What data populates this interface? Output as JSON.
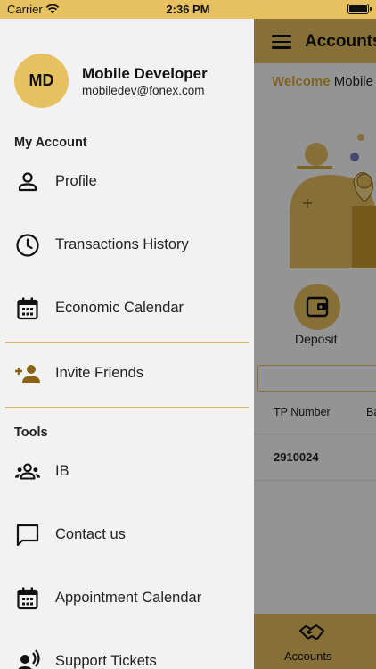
{
  "status_bar": {
    "carrier": "Carrier",
    "time": "2:36 PM"
  },
  "background_screen": {
    "header_title": "Accounts",
    "welcome_prefix": "Welcome",
    "welcome_name": "Mobile",
    "deposit_label": "Deposit",
    "table": {
      "columns": [
        "TP Number",
        "Ba"
      ],
      "rows": [
        [
          "2910024"
        ]
      ]
    },
    "tab_label": "Accounts"
  },
  "user": {
    "initials": "MD",
    "name": "Mobile Developer",
    "email": "mobiledev@fonex.com"
  },
  "my_account": {
    "title": "My Account",
    "items": [
      {
        "label": "Profile",
        "icon": "person-icon"
      },
      {
        "label": "Transactions History",
        "icon": "clock-icon"
      },
      {
        "label": "Economic Calendar",
        "icon": "calendar-icon"
      }
    ]
  },
  "invite": {
    "label": "Invite Friends",
    "icon": "add-person-icon"
  },
  "tools": {
    "title": "Tools",
    "items": [
      {
        "label": "IB",
        "icon": "group-icon"
      },
      {
        "label": "Contact us",
        "icon": "chat-icon"
      },
      {
        "label": "Appointment Calendar",
        "icon": "calendar-icon"
      },
      {
        "label": "Support Tickets",
        "icon": "support-icon"
      }
    ]
  },
  "colors": {
    "accent": "#e7c15f",
    "accent_dark": "#d8ad3d",
    "drawer_bg": "#f2f2f2",
    "invite_icon": "#8a6414"
  }
}
